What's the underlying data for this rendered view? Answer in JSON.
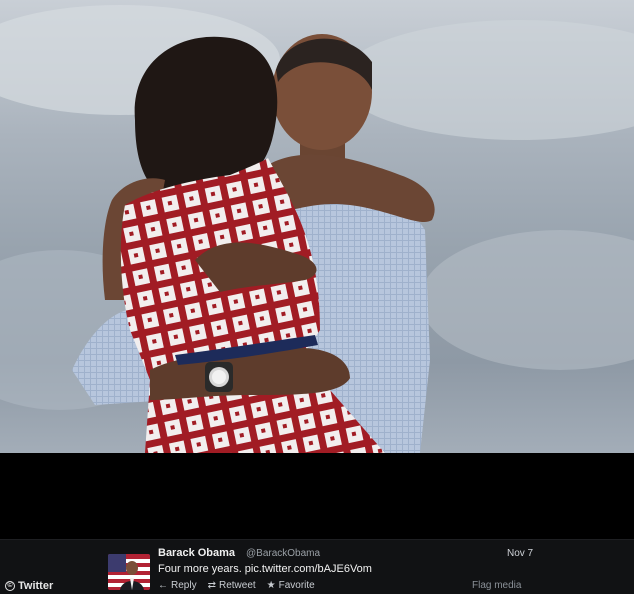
{
  "tweet": {
    "author_name": "Barack Obama",
    "author_handle": "@BarackObama",
    "date": "Nov 7",
    "text": "Four more years. pic.twitter.com/bAJE6Vom",
    "actions": {
      "reply": "Reply",
      "retweet": "Retweet",
      "favorite": "Favorite"
    },
    "flag_label": "Flag media"
  },
  "credit": {
    "label": "Twitter",
    "icon": "copyright-icon"
  },
  "icons": {
    "reply": "reply-arrow-icon",
    "retweet": "retweet-icon",
    "favorite": "star-icon"
  },
  "colors": {
    "bar_background": "#111214",
    "dress_red": "#9e1c22",
    "sky": "#a3adb8"
  }
}
